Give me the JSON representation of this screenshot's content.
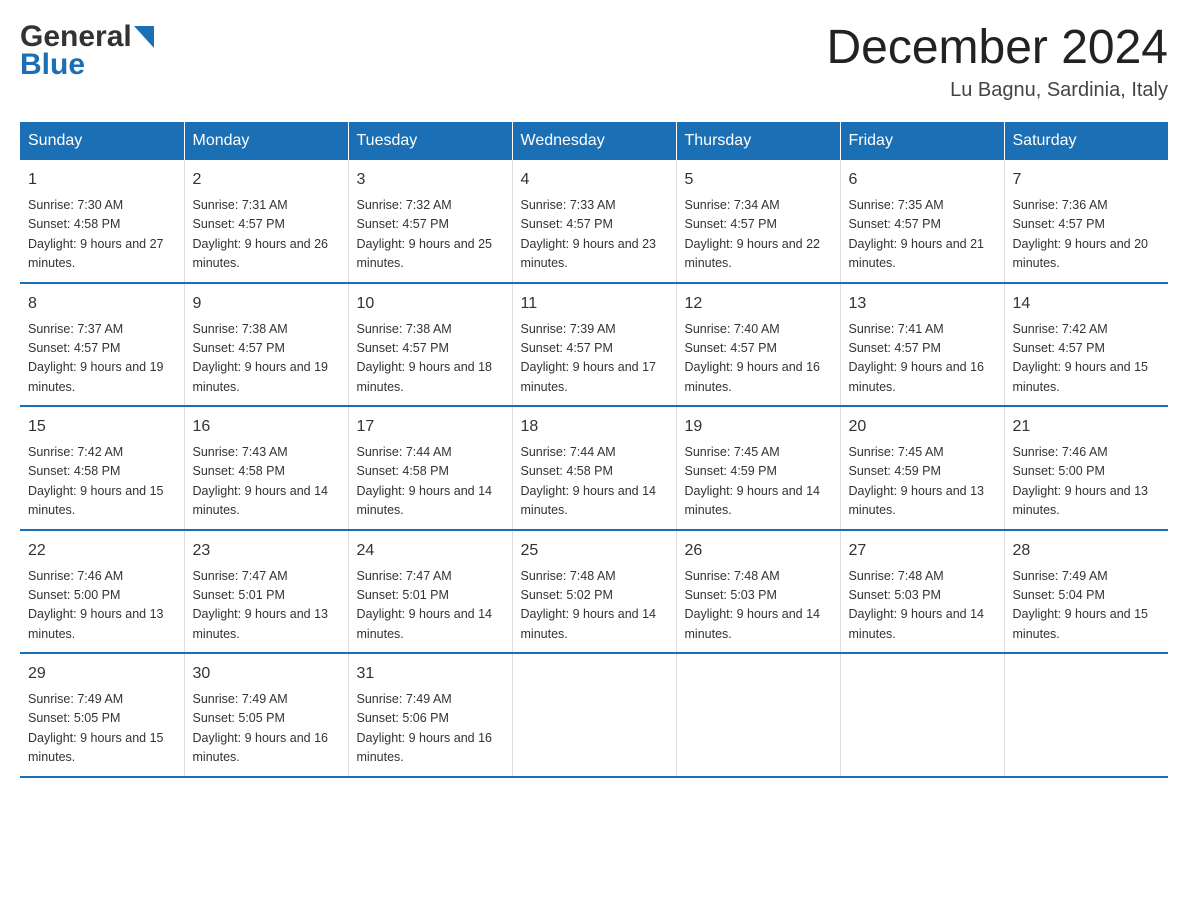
{
  "header": {
    "logo_main": "General",
    "logo_sub": "Blue",
    "month_title": "December 2024",
    "location": "Lu Bagnu, Sardinia, Italy"
  },
  "days_of_week": [
    "Sunday",
    "Monday",
    "Tuesday",
    "Wednesday",
    "Thursday",
    "Friday",
    "Saturday"
  ],
  "weeks": [
    [
      {
        "day": "1",
        "sunrise": "7:30 AM",
        "sunset": "4:58 PM",
        "daylight": "9 hours and 27 minutes."
      },
      {
        "day": "2",
        "sunrise": "7:31 AM",
        "sunset": "4:57 PM",
        "daylight": "9 hours and 26 minutes."
      },
      {
        "day": "3",
        "sunrise": "7:32 AM",
        "sunset": "4:57 PM",
        "daylight": "9 hours and 25 minutes."
      },
      {
        "day": "4",
        "sunrise": "7:33 AM",
        "sunset": "4:57 PM",
        "daylight": "9 hours and 23 minutes."
      },
      {
        "day": "5",
        "sunrise": "7:34 AM",
        "sunset": "4:57 PM",
        "daylight": "9 hours and 22 minutes."
      },
      {
        "day": "6",
        "sunrise": "7:35 AM",
        "sunset": "4:57 PM",
        "daylight": "9 hours and 21 minutes."
      },
      {
        "day": "7",
        "sunrise": "7:36 AM",
        "sunset": "4:57 PM",
        "daylight": "9 hours and 20 minutes."
      }
    ],
    [
      {
        "day": "8",
        "sunrise": "7:37 AM",
        "sunset": "4:57 PM",
        "daylight": "9 hours and 19 minutes."
      },
      {
        "day": "9",
        "sunrise": "7:38 AM",
        "sunset": "4:57 PM",
        "daylight": "9 hours and 19 minutes."
      },
      {
        "day": "10",
        "sunrise": "7:38 AM",
        "sunset": "4:57 PM",
        "daylight": "9 hours and 18 minutes."
      },
      {
        "day": "11",
        "sunrise": "7:39 AM",
        "sunset": "4:57 PM",
        "daylight": "9 hours and 17 minutes."
      },
      {
        "day": "12",
        "sunrise": "7:40 AM",
        "sunset": "4:57 PM",
        "daylight": "9 hours and 16 minutes."
      },
      {
        "day": "13",
        "sunrise": "7:41 AM",
        "sunset": "4:57 PM",
        "daylight": "9 hours and 16 minutes."
      },
      {
        "day": "14",
        "sunrise": "7:42 AM",
        "sunset": "4:57 PM",
        "daylight": "9 hours and 15 minutes."
      }
    ],
    [
      {
        "day": "15",
        "sunrise": "7:42 AM",
        "sunset": "4:58 PM",
        "daylight": "9 hours and 15 minutes."
      },
      {
        "day": "16",
        "sunrise": "7:43 AM",
        "sunset": "4:58 PM",
        "daylight": "9 hours and 14 minutes."
      },
      {
        "day": "17",
        "sunrise": "7:44 AM",
        "sunset": "4:58 PM",
        "daylight": "9 hours and 14 minutes."
      },
      {
        "day": "18",
        "sunrise": "7:44 AM",
        "sunset": "4:58 PM",
        "daylight": "9 hours and 14 minutes."
      },
      {
        "day": "19",
        "sunrise": "7:45 AM",
        "sunset": "4:59 PM",
        "daylight": "9 hours and 14 minutes."
      },
      {
        "day": "20",
        "sunrise": "7:45 AM",
        "sunset": "4:59 PM",
        "daylight": "9 hours and 13 minutes."
      },
      {
        "day": "21",
        "sunrise": "7:46 AM",
        "sunset": "5:00 PM",
        "daylight": "9 hours and 13 minutes."
      }
    ],
    [
      {
        "day": "22",
        "sunrise": "7:46 AM",
        "sunset": "5:00 PM",
        "daylight": "9 hours and 13 minutes."
      },
      {
        "day": "23",
        "sunrise": "7:47 AM",
        "sunset": "5:01 PM",
        "daylight": "9 hours and 13 minutes."
      },
      {
        "day": "24",
        "sunrise": "7:47 AM",
        "sunset": "5:01 PM",
        "daylight": "9 hours and 14 minutes."
      },
      {
        "day": "25",
        "sunrise": "7:48 AM",
        "sunset": "5:02 PM",
        "daylight": "9 hours and 14 minutes."
      },
      {
        "day": "26",
        "sunrise": "7:48 AM",
        "sunset": "5:03 PM",
        "daylight": "9 hours and 14 minutes."
      },
      {
        "day": "27",
        "sunrise": "7:48 AM",
        "sunset": "5:03 PM",
        "daylight": "9 hours and 14 minutes."
      },
      {
        "day": "28",
        "sunrise": "7:49 AM",
        "sunset": "5:04 PM",
        "daylight": "9 hours and 15 minutes."
      }
    ],
    [
      {
        "day": "29",
        "sunrise": "7:49 AM",
        "sunset": "5:05 PM",
        "daylight": "9 hours and 15 minutes."
      },
      {
        "day": "30",
        "sunrise": "7:49 AM",
        "sunset": "5:05 PM",
        "daylight": "9 hours and 16 minutes."
      },
      {
        "day": "31",
        "sunrise": "7:49 AM",
        "sunset": "5:06 PM",
        "daylight": "9 hours and 16 minutes."
      },
      {
        "day": "",
        "sunrise": "",
        "sunset": "",
        "daylight": ""
      },
      {
        "day": "",
        "sunrise": "",
        "sunset": "",
        "daylight": ""
      },
      {
        "day": "",
        "sunrise": "",
        "sunset": "",
        "daylight": ""
      },
      {
        "day": "",
        "sunrise": "",
        "sunset": "",
        "daylight": ""
      }
    ]
  ]
}
